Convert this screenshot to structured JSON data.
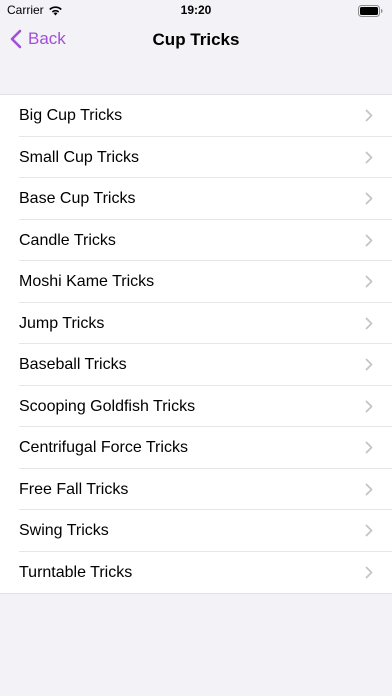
{
  "status_bar": {
    "carrier": "Carrier",
    "time": "19:20"
  },
  "nav": {
    "back_label": "Back",
    "title": "Cup Tricks"
  },
  "tricks": [
    {
      "label": "Big Cup Tricks"
    },
    {
      "label": "Small Cup Tricks"
    },
    {
      "label": "Base Cup Tricks"
    },
    {
      "label": "Candle Tricks"
    },
    {
      "label": "Moshi Kame Tricks"
    },
    {
      "label": "Jump Tricks"
    },
    {
      "label": "Baseball Tricks"
    },
    {
      "label": "Scooping Goldfish Tricks"
    },
    {
      "label": "Centrifugal Force Tricks"
    },
    {
      "label": "Free Fall Tricks"
    },
    {
      "label": "Swing Tricks"
    },
    {
      "label": "Turntable Tricks"
    }
  ],
  "colors": {
    "accent": "#a24fd8",
    "background": "#f2f2f7",
    "chevron": "#c4c4c7"
  }
}
